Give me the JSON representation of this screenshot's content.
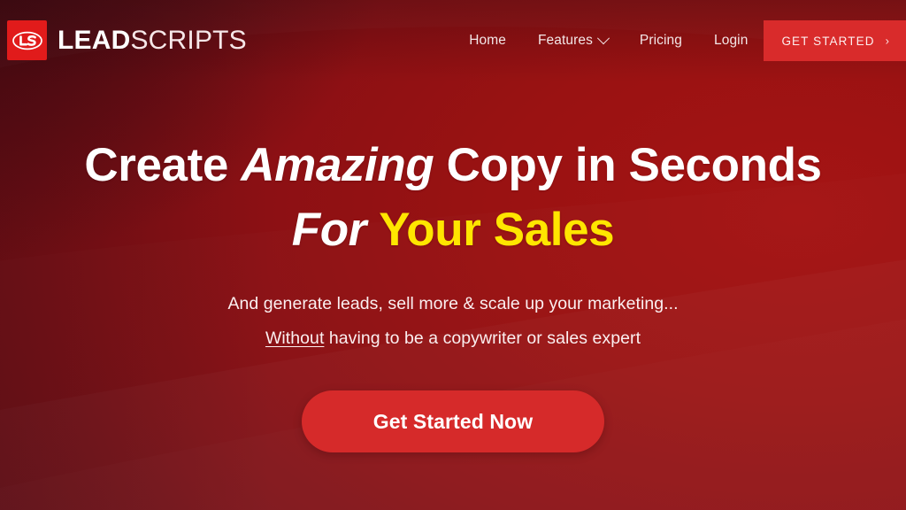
{
  "brand": {
    "mark_icon": "ls-monogram-icon",
    "name_bold": "LEAD",
    "name_light": "SCRIPTS"
  },
  "nav": {
    "items": [
      {
        "label": "Home",
        "icon": null
      },
      {
        "label": "Features",
        "icon": "chevron-down-icon"
      },
      {
        "label": "Pricing",
        "icon": null
      },
      {
        "label": "Login",
        "icon": null
      }
    ],
    "cta": {
      "label": "GET STARTED",
      "arrow": "›",
      "icon": "chevron-right-icon",
      "bg": "#d92b2b"
    }
  },
  "hero": {
    "headline_line1": {
      "part1": "Create ",
      "emphasis": "Amazing",
      "part2": " Copy in Seconds"
    },
    "headline_line2": {
      "emphasis": "For ",
      "highlight": "Your Sales",
      "highlight_color": "#ffe600"
    },
    "sub_line1": "And generate leads, sell more & scale up your marketing...",
    "sub_line2": {
      "underlined": "Without",
      "rest": " having to be a copywriter or sales expert"
    },
    "cta_label": "Get Started Now",
    "cta_bg": "#d62a2a"
  },
  "theme": {
    "background_dark": "#62101a",
    "background_mid": "#8a1014",
    "background_bright": "#a51414",
    "text_primary": "#ffffff",
    "accent_yellow": "#ffe600",
    "accent_red": "#d92b2b"
  }
}
